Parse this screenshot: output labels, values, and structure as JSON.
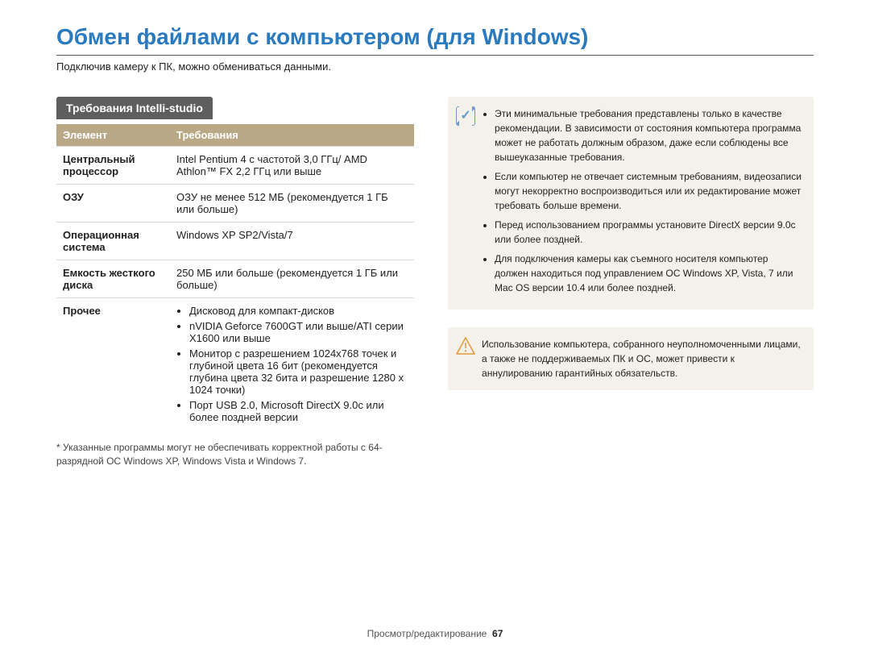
{
  "title": "Обмен файлами с компьютером (для Windows)",
  "intro": "Подключив камеру к ПК, можно обмениваться данными.",
  "section_tab": "Требования Intelli-studio",
  "table": {
    "header_left": "Элемент",
    "header_right": "Требования",
    "rows": [
      {
        "key": "Центральный процессор",
        "value": "Intel Pentium 4 с частотой 3,0 ГГц/\nAMD Athlon™ FX 2,2 ГГц или выше"
      },
      {
        "key": "ОЗУ",
        "value": "ОЗУ не менее 512 МБ\n(рекомендуется 1 ГБ или больше)"
      },
      {
        "key": "Операционная система",
        "value": "Windows XP SP2/Vista/7"
      },
      {
        "key": "Емкость жесткого диска",
        "value": "250 МБ или больше\n(рекомендуется 1 ГБ или больше)"
      }
    ],
    "other_key": "Прочее",
    "other_items": [
      "Дисковод для компакт-дисков",
      "nVIDIA Geforce 7600GT или выше/ATI серии X1600 или выше",
      "Монитор с разрешением 1024x768 точек и глубиной цвета 16 бит (рекомендуется глубина цвета 32 бита и разрешение 1280 x 1024 точки)",
      "Порт USB 2.0, Microsoft DirectX 9.0c или более поздней версии"
    ]
  },
  "footnote": "* Указанные программы могут не обеспечивать корректной работы с 64-разрядной ОС Windows XP, Windows Vista и Windows 7.",
  "note_items": [
    "Эти минимальные требования представлены только в качестве рекомендации. В зависимости от состояния компьютера программа может не работать должным образом, даже если соблюдены все вышеуказанные требования.",
    "Если компьютер не отвечает системным требованиям, видеозаписи могут некорректно воспроизводиться или их редактирование может требовать больше времени.",
    "Перед использованием программы установите DirectX версии 9.0c или более поздней.",
    "Для подключения камеры как съемного носителя компьютер должен находиться под управлением ОС Windows XP, Vista, 7 или Mac OS версии 10.4 или более поздней."
  ],
  "warning_text": "Использование компьютера, собранного неуполномоченными лицами, а также не поддерживаемых ПК и ОС, может привести к аннулированию гарантийных обязательств.",
  "footer_label": "Просмотр/редактирование",
  "page_number": "67"
}
